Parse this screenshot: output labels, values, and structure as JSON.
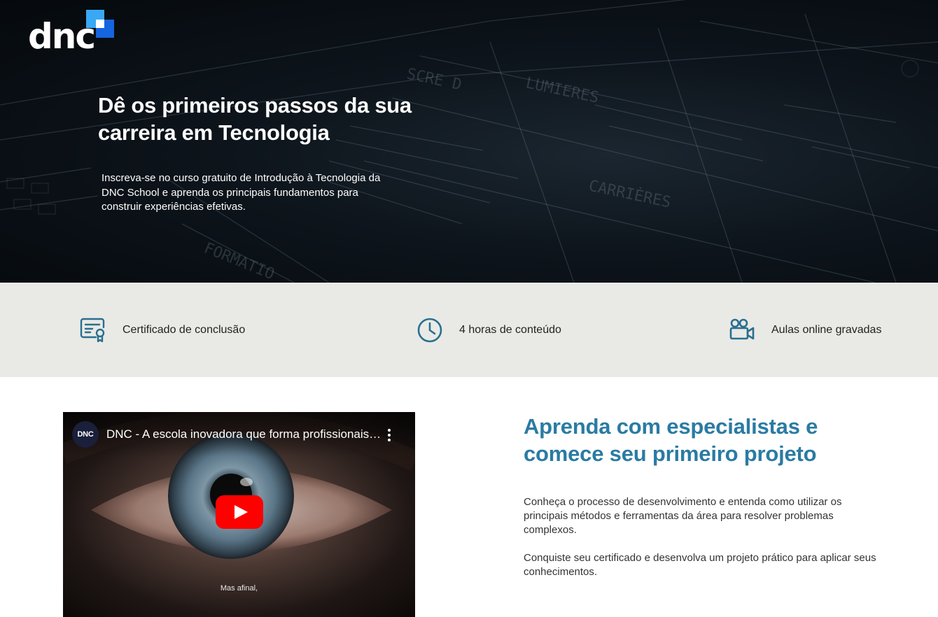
{
  "header": {
    "logo_text": "dnc",
    "brand_colors": {
      "square_light": "#39a8f5",
      "square_dark": "#1565e0"
    }
  },
  "hero": {
    "title": "Dê os primeiros passos da sua carreira em Tecnologia",
    "subtitle": "Inscreva-se no curso gratuito de Introdução à Tecnologia da DNC School e aprenda os principais fundamentos para construir experiências efetivas."
  },
  "features": [
    {
      "icon": "certificate-icon",
      "label": "Certificado de conclusão"
    },
    {
      "icon": "clock-icon",
      "label": "4 horas de conteúdo"
    },
    {
      "icon": "video-camera-icon",
      "label": "Aulas online gravadas"
    }
  ],
  "video": {
    "channel_avatar": "DNC",
    "title": "DNC - A escola inovadora que forma profissionais…",
    "caption": "Mas afinal,"
  },
  "section": {
    "title": "Aprenda com especialistas e comece seu primeiro projeto",
    "paragraphs": [
      "Conheça o processo de desenvolvimento e entenda como utilizar os principais métodos e ferramentas da área para resolver problemas complexos.",
      "Conquiste seu certificado e desenvolva um projeto prático para aplicar seus conhecimentos."
    ]
  },
  "colors": {
    "accent": "#2a7ba3",
    "feature_bar": "#e9eae6",
    "icon": "#2a6f8f"
  }
}
